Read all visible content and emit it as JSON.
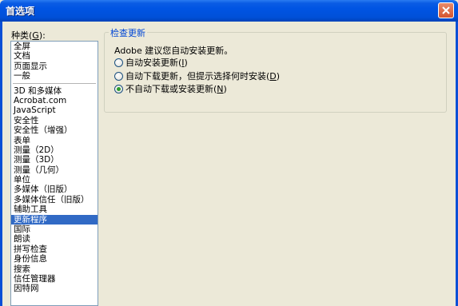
{
  "window": {
    "title": "首选项"
  },
  "sidebar": {
    "label_prefix": "种类(",
    "label_key": "G",
    "label_suffix": "):",
    "groups": [
      [
        "全屏",
        "文档",
        "页面显示",
        "一般"
      ],
      [
        "3D 和多媒体",
        "Acrobat.com",
        "JavaScript",
        "安全性",
        "安全性（增强）",
        "表单",
        "测量（2D）",
        "测量（3D）",
        "测量（几何）",
        "单位",
        "多媒体（旧版）",
        "多媒体信任（旧版）",
        "辅助工具",
        "更新程序",
        "国际",
        "朗读",
        "拼写检查",
        "身份信息",
        "搜索",
        "信任管理器",
        "因特网"
      ]
    ],
    "selected": "更新程序"
  },
  "update_panel": {
    "legend": "检查更新",
    "description": "Adobe 建议您自动安装更新。",
    "options": [
      {
        "pre": "自动安装更新(",
        "key": "I",
        "post": ")",
        "checked": false
      },
      {
        "pre": "自动下载更新，但提示选择何时安装(",
        "key": "D",
        "post": ")",
        "checked": false
      },
      {
        "pre": "不自动下载或安装更新(",
        "key": "N",
        "post": ")",
        "checked": true
      }
    ]
  }
}
